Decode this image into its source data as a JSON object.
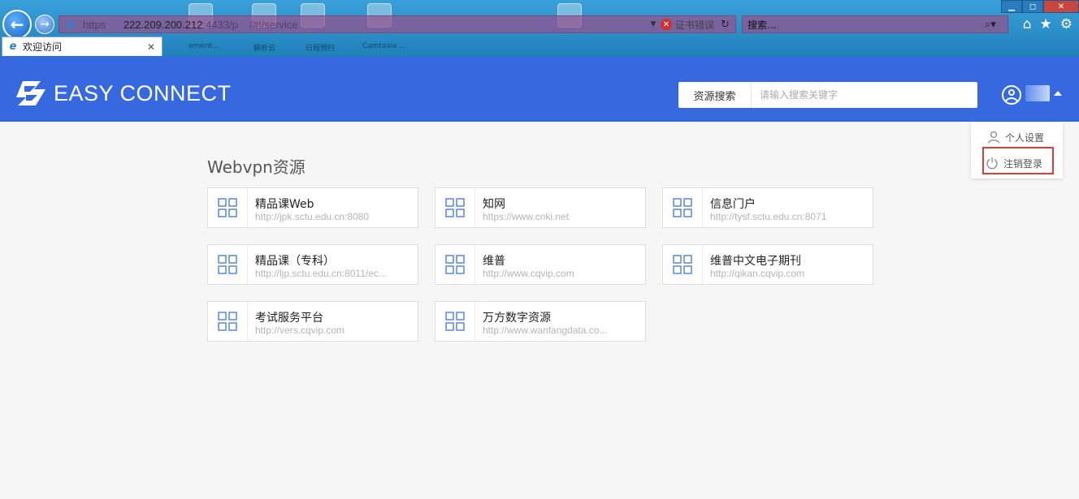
{
  "browser": {
    "address_url_visible": "https",
    "address_url_main": "222.209.200.212",
    "address_url_tail": ":4433/p",
    "address_url_hash": "/#!/service",
    "cert_error": "证书错误",
    "search_placeholder": "搜索...",
    "tab_title": "欢迎访问",
    "desktop_labels": [
      "ement...",
      "解析云",
      "日程预约",
      "Camtasia ..."
    ]
  },
  "header": {
    "brand": "EASY CONNECT",
    "search_label": "资源搜索",
    "search_placeholder": "请输入搜索关键字"
  },
  "user_menu": {
    "items": [
      {
        "label": "个人设置",
        "icon": "user-icon"
      },
      {
        "label": "注销登录",
        "icon": "power-icon"
      }
    ]
  },
  "section": {
    "title": "Webvpn资源"
  },
  "resources": [
    {
      "name": "精品课Web",
      "url": "http://jpk.sctu.edu.cn:8080"
    },
    {
      "name": "知网",
      "url": "https://www.cnki.net"
    },
    {
      "name": "信息门户",
      "url": "http://tysf.sctu.edu.cn:8071"
    },
    {
      "name": "精品课（专科）",
      "url": "http://ljp.sctu.edu.cn:8011/ec..."
    },
    {
      "name": "维普",
      "url": "http://www.cqvip.com"
    },
    {
      "name": "维普中文电子期刊",
      "url": "http://qikan.cqvip.com"
    },
    {
      "name": "考试服务平台",
      "url": "http://vers.cqvip.com"
    },
    {
      "name": "万方数字资源",
      "url": "http://www.wanfangdata.co..."
    }
  ],
  "colors": {
    "header_bg": "#3669e0",
    "highlight": "#e53935",
    "resource_icon": "#4a7fe0"
  }
}
